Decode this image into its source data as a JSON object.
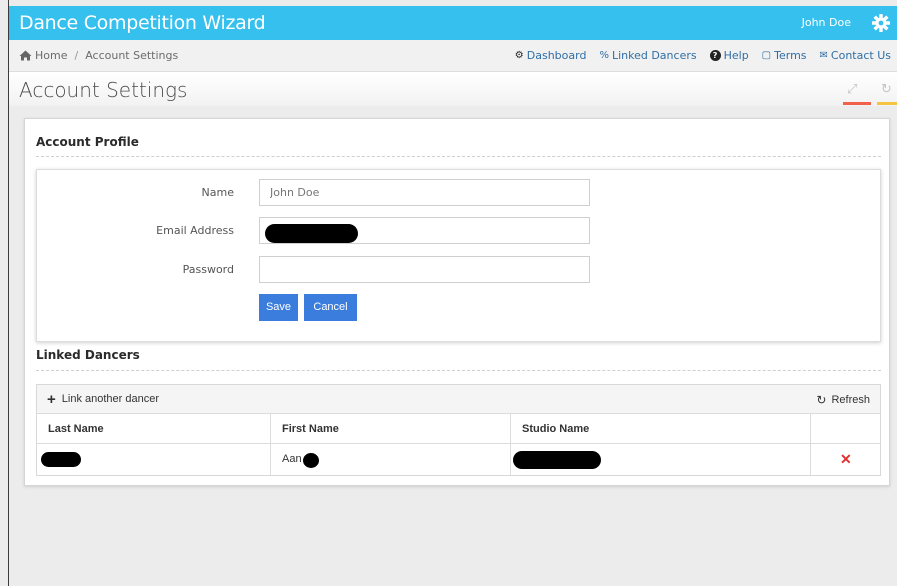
{
  "app": {
    "title": "Dance Competition Wizard",
    "user": "John Doe"
  },
  "breadcrumb": {
    "home": "Home",
    "sep": "/",
    "current": "Account Settings"
  },
  "nav": [
    {
      "label": "Dashboard",
      "icon": "dashboard-icon",
      "glyph": "⚙"
    },
    {
      "label": "Linked Dancers",
      "icon": "link-icon",
      "glyph": "%"
    },
    {
      "label": "Help",
      "icon": "help-icon",
      "glyph": "?"
    },
    {
      "label": "Terms",
      "icon": "document-icon",
      "glyph": "▢"
    },
    {
      "label": "Contact Us",
      "icon": "envelope-icon",
      "glyph": "✉"
    }
  ],
  "page": {
    "title": "Account Settings"
  },
  "profile": {
    "heading": "Account Profile",
    "name_label": "Name",
    "name_placeholder": "John Doe",
    "email_label": "Email Address",
    "email_value": "",
    "password_label": "Password",
    "password_value": "",
    "save_label": "Save",
    "cancel_label": "Cancel"
  },
  "linked": {
    "heading": "Linked Dancers",
    "link_label": "Link another dancer",
    "refresh_label": "Refresh",
    "columns": [
      "Last Name",
      "First Name",
      "Studio Name"
    ],
    "rows": [
      {
        "last": "",
        "first": "Aan",
        "studio": ""
      }
    ]
  },
  "colors": {
    "topbar": "#36c0ed",
    "primary": "#3b7ddd",
    "delete": "#e03030",
    "accent_red": "#f0604a",
    "accent_yellow": "#f5c542"
  }
}
